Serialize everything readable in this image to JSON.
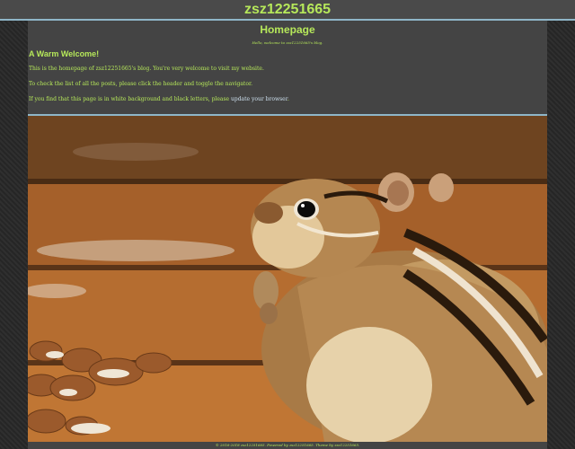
{
  "header": {
    "site_title": "zsz12251665"
  },
  "main": {
    "page_title": "Homepage",
    "subtitle": "Hello, welcome to zsz12251665's blog.",
    "section_heading": "A Warm Welcome!",
    "para1": "This is the homepage of zsz12251665's blog. You're very welcome to visit my website.",
    "para2": "To check the list of all the posts, please click the header and toggle the navigator.",
    "para3_prefix": "If you find that this page is in white background and black letters, please ",
    "para3_link": "update your browser",
    "para3_suffix": "."
  },
  "footer": {
    "text": "© 2016-2018 zsz12251665. Powered by zsz12251665. Theme by zsz12251665."
  },
  "colors": {
    "accent": "#b6e85a",
    "divider": "#8fb6c8",
    "panel": "#444444"
  }
}
